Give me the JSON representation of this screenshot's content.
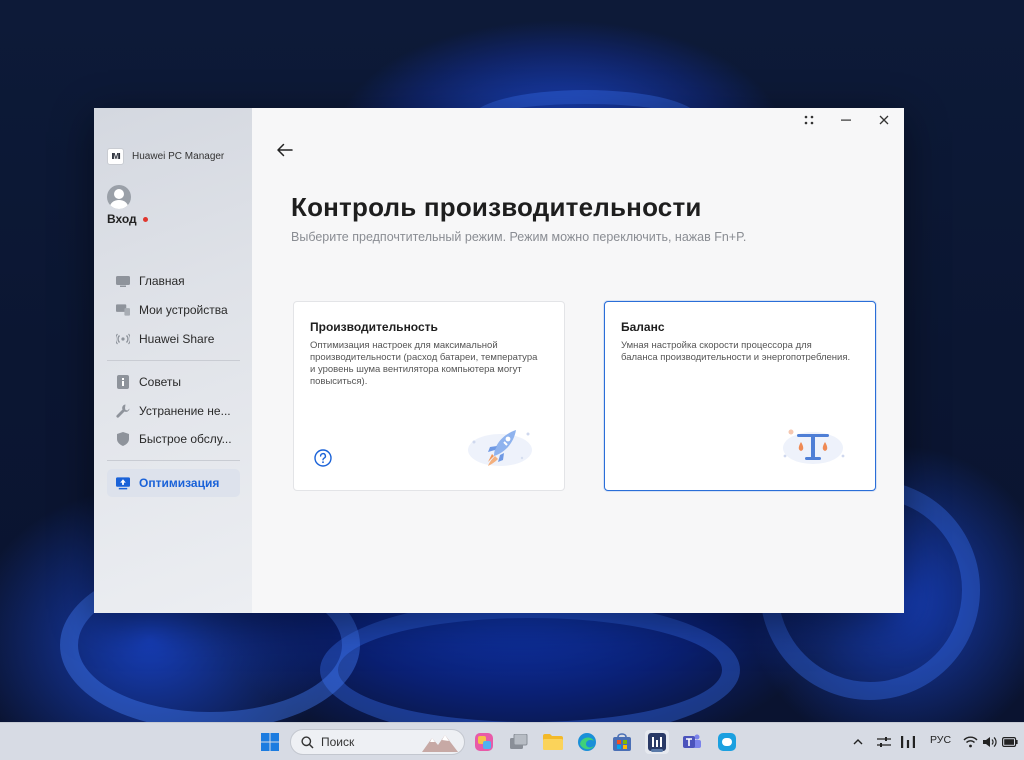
{
  "app": {
    "name": "Huawei PC Manager",
    "logo_text": "IMI"
  },
  "account": {
    "login_label": "Вход"
  },
  "sidebar": {
    "items": [
      {
        "label": "Главная",
        "icon": "home-icon"
      },
      {
        "label": "Мои устройства",
        "icon": "devices-icon"
      },
      {
        "label": "Huawei Share",
        "icon": "share-icon"
      },
      {
        "label": "Советы",
        "icon": "tips-icon"
      },
      {
        "label": "Устранение не...",
        "icon": "wrench-icon"
      },
      {
        "label": "Быстрое обслу...",
        "icon": "shield-icon"
      },
      {
        "label": "Оптимизация",
        "icon": "optimize-icon",
        "active": true
      }
    ]
  },
  "page": {
    "title": "Контроль производительности",
    "subtitle": "Выберите предпочтительный режим. Режим можно переключить, нажав Fn+P."
  },
  "modes": [
    {
      "title": "Производительность",
      "description": "Оптимизация настроек для максимальной производительности (расход батареи, температура и уровень шума вентилятора компьютера могут повыситься).",
      "selected": false
    },
    {
      "title": "Баланс",
      "description": "Умная настройка скорости процессора для баланса производительности и энергопотребления.",
      "selected": true
    }
  ],
  "taskbar": {
    "search_placeholder": "Поиск",
    "language": "РУС"
  },
  "colors": {
    "accent": "#1a62d8",
    "selected_border": "#2a6ed8",
    "notification_dot": "#e0372e"
  }
}
